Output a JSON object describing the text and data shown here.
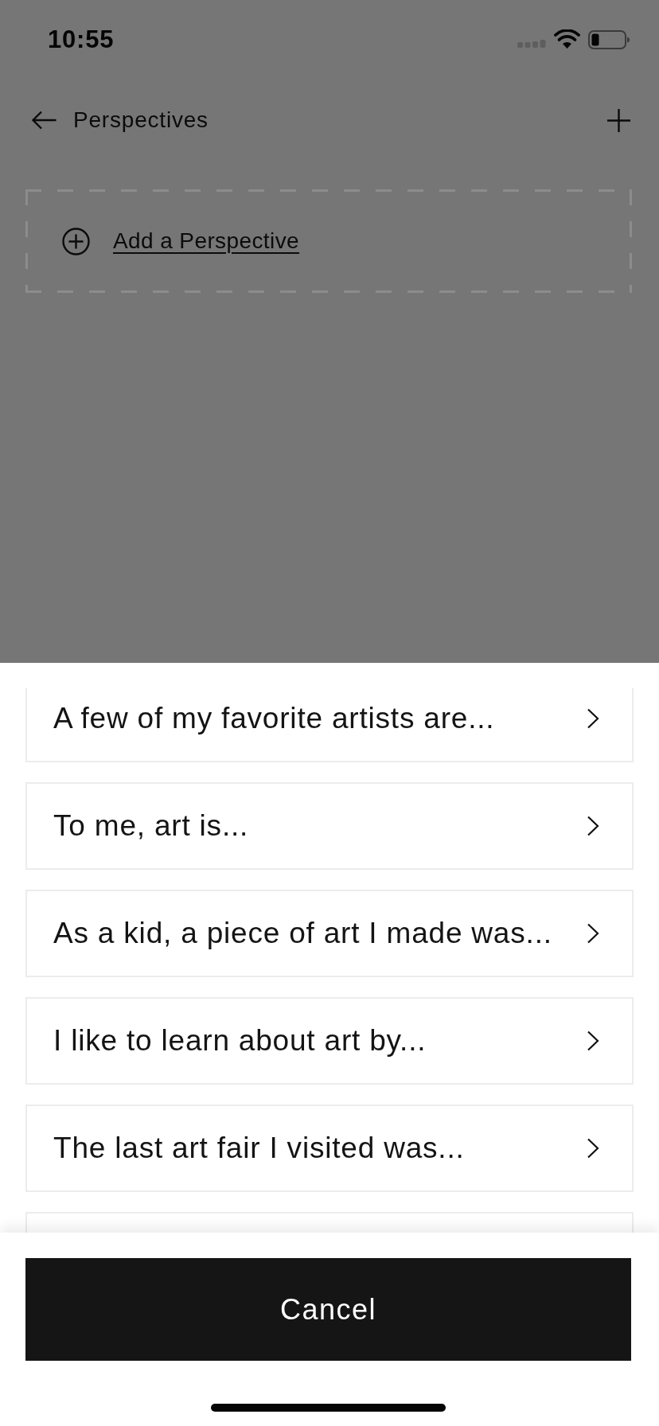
{
  "status_bar": {
    "time": "10:55"
  },
  "header": {
    "title": "Perspectives"
  },
  "add_perspective": {
    "label": "Add a Perspective"
  },
  "sheet": {
    "prompts": [
      {
        "label": "A few of my favorite artists are..."
      },
      {
        "label": "To me, art is..."
      },
      {
        "label": "As a kid, a piece of art I made was..."
      },
      {
        "label": "I like to learn about art by..."
      },
      {
        "label": "The last art fair I visited was..."
      }
    ],
    "more_below": true,
    "cancel_button": "Cancel"
  }
}
